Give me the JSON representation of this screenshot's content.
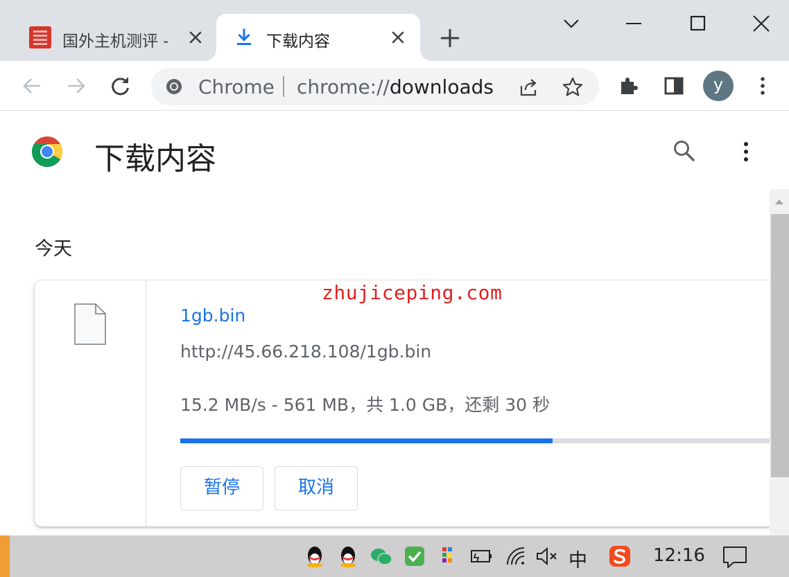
{
  "tabs": [
    {
      "title": "国外主机测评 -",
      "active": false,
      "favicon": "site-favicon"
    },
    {
      "title": "下载内容",
      "active": true,
      "favicon": "download-icon"
    }
  ],
  "window_controls": [
    "chevron-down-icon",
    "minimize-icon",
    "maximize-icon",
    "close-icon"
  ],
  "toolbar": {
    "site_label": "Chrome",
    "url_scheme": "chrome://",
    "url_host": "downloads",
    "avatar_initial": "y"
  },
  "page": {
    "title": "下载内容",
    "section_date": "今天"
  },
  "download": {
    "file_name": "1gb.bin",
    "url": "http://45.66.218.108/1gb.bin",
    "status": "15.2 MB/s - 561 MB，共 1.0 GB，还剩 30 秒",
    "progress_fraction": 0.63,
    "pause_label": "暂停",
    "cancel_label": "取消"
  },
  "watermark": "zhujiceping.com",
  "taskbar": {
    "ime_label": "中",
    "clock": "12:16"
  },
  "colors": {
    "accent": "#1a73e8",
    "tabstrip": "#dee1e6",
    "watermark": "#e02020"
  }
}
